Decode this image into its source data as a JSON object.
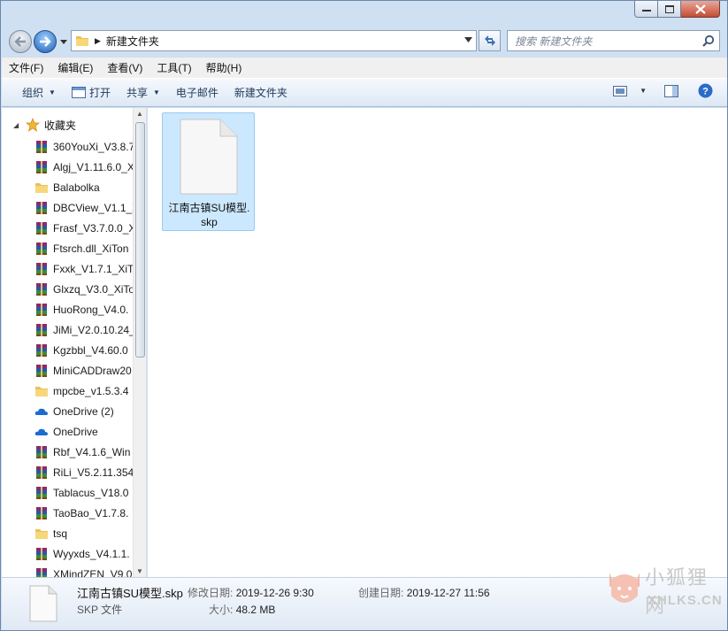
{
  "window": {
    "title_buttons": [
      "minimize-icon",
      "maximize-icon",
      "close-icon"
    ]
  },
  "address": {
    "path": "新建文件夹",
    "search_placeholder": "搜索 新建文件夹"
  },
  "menu": [
    "文件(F)",
    "编辑(E)",
    "查看(V)",
    "工具(T)",
    "帮助(H)"
  ],
  "toolbar": {
    "organize": "组织",
    "open": "打开",
    "share": "共享",
    "email": "电子邮件",
    "new_folder": "新建文件夹"
  },
  "nav": {
    "favorites": "收藏夹",
    "items": [
      {
        "label": "360YouXi_V3.8.7",
        "icon": "rar-archive-icon"
      },
      {
        "label": "Algj_V1.11.6.0_X",
        "icon": "rar-archive-icon"
      },
      {
        "label": "Balabolka",
        "icon": "folder-icon"
      },
      {
        "label": "DBCView_V1.1_X",
        "icon": "rar-archive-icon"
      },
      {
        "label": "Frasf_V3.7.0.0_X",
        "icon": "rar-archive-icon"
      },
      {
        "label": "Ftsrch.dll_XiTon",
        "icon": "rar-archive-icon"
      },
      {
        "label": "Fxxk_V1.7.1_XiT",
        "icon": "rar-archive-icon"
      },
      {
        "label": "Glxzq_V3.0_XiTo",
        "icon": "rar-archive-icon"
      },
      {
        "label": "HuoRong_V4.0.",
        "icon": "rar-archive-icon"
      },
      {
        "label": "JiMi_V2.0.10.24_",
        "icon": "rar-archive-icon"
      },
      {
        "label": "Kgzbbl_V4.60.0",
        "icon": "rar-archive-icon"
      },
      {
        "label": "MiniCADDraw20",
        "icon": "rar-archive-icon"
      },
      {
        "label": "mpcbe_v1.5.3.4",
        "icon": "folder-icon"
      },
      {
        "label": "OneDrive (2)",
        "icon": "onedrive-icon"
      },
      {
        "label": "OneDrive",
        "icon": "onedrive-icon"
      },
      {
        "label": "Rbf_V4.1.6_Win",
        "icon": "rar-archive-icon"
      },
      {
        "label": "RiLi_V5.2.11.354",
        "icon": "rar-archive-icon"
      },
      {
        "label": "Tablacus_V18.0",
        "icon": "rar-archive-icon"
      },
      {
        "label": "TaoBao_V1.7.8.",
        "icon": "rar-archive-icon"
      },
      {
        "label": "tsq",
        "icon": "folder-icon"
      },
      {
        "label": "Wyyxds_V4.1.1.",
        "icon": "rar-archive-icon"
      },
      {
        "label": "XMindZEN_V9.0",
        "icon": "rar-archive-icon"
      }
    ]
  },
  "files": [
    {
      "name_line1": "江南古镇SU模型.",
      "name_line2": "skp",
      "icon": "blank-document-icon"
    }
  ],
  "details": {
    "file_name": "江南古镇SU模型.skp",
    "file_type": "SKP 文件",
    "modified_label": "修改日期:",
    "modified_value": "2019-12-26 9:30",
    "created_label": "创建日期:",
    "created_value": "2019-12-27 11:56",
    "size_label": "大小:",
    "size_value": "48.2 MB"
  },
  "watermark": {
    "line1": "小狐狸网",
    "line2": "XHLKS.CN"
  },
  "colors": {
    "frame": "#cfe0f3",
    "selection": "#cce8ff",
    "toolbar_text": "#1e395b"
  }
}
